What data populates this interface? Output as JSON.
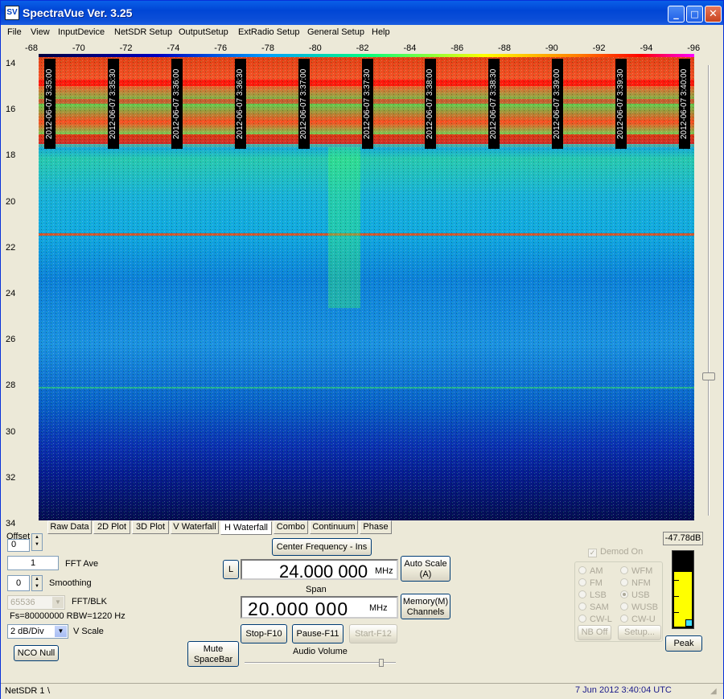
{
  "window": {
    "title": "SpectraVue Ver. 3.25",
    "icon_text": "SV",
    "minimize": "_",
    "maximize": "□",
    "close": "✕"
  },
  "menu": [
    "File",
    "View",
    "InputDevice",
    "NetSDR Setup",
    "OutputSetup",
    "ExtRadio Setup",
    "General Setup",
    "Help"
  ],
  "top_scale": [
    "-68",
    "-70",
    "-72",
    "-74",
    "-76",
    "-78",
    "-80",
    "-82",
    "-84",
    "-86",
    "-88",
    "-90",
    "-92",
    "-94",
    "-96"
  ],
  "y_scale": [
    "14",
    "16",
    "18",
    "20",
    "22",
    "24",
    "26",
    "28",
    "30",
    "32",
    "34"
  ],
  "timestamps": [
    "2012-06-07 3:35:00",
    "2012-06-07 3:35:30",
    "2012-06-07 3:36:00",
    "2012-06-07 3:36:30",
    "2012-06-07 3:37:00",
    "2012-06-07 3:37:30",
    "2012-06-07 3:38:00",
    "2012-06-07 3:38:30",
    "2012-06-07 3:39:00",
    "2012-06-07 3:39:30",
    "2012-06-07 3:40:00"
  ],
  "tabs": [
    "Raw Data",
    "2D Plot",
    "3D Plot",
    "V Waterfall",
    "H Waterfall",
    "Combo",
    "Continuum",
    "Phase"
  ],
  "active_tab": "H Waterfall",
  "controls": {
    "offset_label": "Offset",
    "offset_value": "0",
    "fft_ave_value": "1",
    "fft_ave_label": "FFT Ave",
    "smoothing_value": "0",
    "smoothing_label": "Smoothing",
    "fft_blk_value": "65536",
    "fft_blk_label": "FFT/BLK",
    "fs_text": "Fs=80000000 RBW=1220 Hz",
    "vscale_value": "2 dB/Div",
    "vscale_label": "V Scale",
    "nco_null": "NCO Null",
    "mute_line1": "Mute",
    "mute_line2": "SpaceBar",
    "center_freq_button": "Center Frequency - Ins",
    "l_button": "L",
    "center_freq_value": "24.000 000",
    "center_freq_unit": "MHz",
    "span_label": "Span",
    "span_value": "20.000 000",
    "span_unit": "MHz",
    "auto_scale_line1": "Auto Scale",
    "auto_scale_line2": "(A)",
    "memory_line1": "Memory(M)",
    "memory_line2": "Channels",
    "stop": "Stop-F10",
    "pause": "Pause-F11",
    "start": "Start-F12",
    "audio_volume": "Audio Volume",
    "audio_volume_level": 0.92
  },
  "demod": {
    "label": "Demod On",
    "modes": [
      "AM",
      "WFM",
      "FM",
      "NFM",
      "LSB",
      "USB",
      "SAM",
      "WUSB",
      "CW-L",
      "CW-U"
    ],
    "selected": "USB",
    "nb_off": "NB Off",
    "setup": "Setup..."
  },
  "meter": {
    "value": "-47.78dB",
    "peak": "Peak",
    "fill_fraction": 0.72
  },
  "status": {
    "left": "NetSDR 1",
    "sep": "\\",
    "datetime": "7 Jun 2012  3:40:04 UTC"
  },
  "colors": {
    "accent": "#0046d5",
    "waterfall_low": "#0a1fa0",
    "waterfall_high": "#ff0000"
  }
}
